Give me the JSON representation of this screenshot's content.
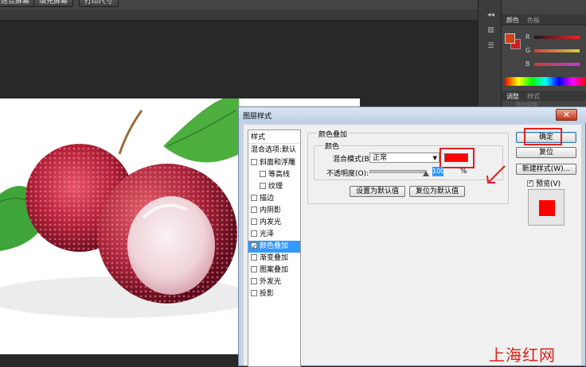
{
  "toolbar": {
    "buttons": [
      "适合屏幕",
      "填充屏幕",
      "打印尺寸"
    ]
  },
  "right_panel": {
    "tabs_top": [
      "颜色",
      "色板"
    ],
    "sliders": [
      "R",
      "G",
      "B"
    ],
    "tabs_bottom": [
      "调整",
      "样式"
    ],
    "gray_text": "添加调整",
    "colors": {
      "foreground": "#d0421b",
      "background": "#cc2020"
    }
  },
  "dialog": {
    "title": "图层样式",
    "close_label": "✕",
    "style_list": {
      "header": "样式",
      "blend_item": "混合选项:默认",
      "items": [
        {
          "label": "斜面和浮雕",
          "checked": false,
          "indent": false,
          "selected": false
        },
        {
          "label": "等高线",
          "checked": false,
          "indent": true,
          "selected": false
        },
        {
          "label": "纹理",
          "checked": false,
          "indent": true,
          "selected": false
        },
        {
          "label": "描边",
          "checked": false,
          "indent": false,
          "selected": false
        },
        {
          "label": "内阴影",
          "checked": false,
          "indent": false,
          "selected": false
        },
        {
          "label": "内发光",
          "checked": false,
          "indent": false,
          "selected": false
        },
        {
          "label": "光泽",
          "checked": false,
          "indent": false,
          "selected": false
        },
        {
          "label": "颜色叠加",
          "checked": true,
          "indent": false,
          "selected": true
        },
        {
          "label": "渐变叠加",
          "checked": false,
          "indent": false,
          "selected": false
        },
        {
          "label": "图案叠加",
          "checked": false,
          "indent": false,
          "selected": false
        },
        {
          "label": "外发光",
          "checked": false,
          "indent": false,
          "selected": false
        },
        {
          "label": "投影",
          "checked": false,
          "indent": false,
          "selected": false
        }
      ]
    },
    "color_overlay": {
      "group_title": "颜色叠加",
      "sub_title": "颜色",
      "blend_mode_label": "混合模式(B):",
      "blend_mode_value": "正常",
      "opacity_label": "不透明度(O):",
      "opacity_value": "100",
      "opacity_unit": "%",
      "opacity_fraction": 1.0,
      "overlay_color": "#ff0000",
      "set_default": "设置为默认值",
      "reset_default": "复位为默认值"
    },
    "buttons": {
      "ok": "确定",
      "reset": "复位",
      "new_style": "新建样式(W)...",
      "preview_label": "预览(V)",
      "preview_checked": true
    }
  },
  "watermark": "上海红网"
}
